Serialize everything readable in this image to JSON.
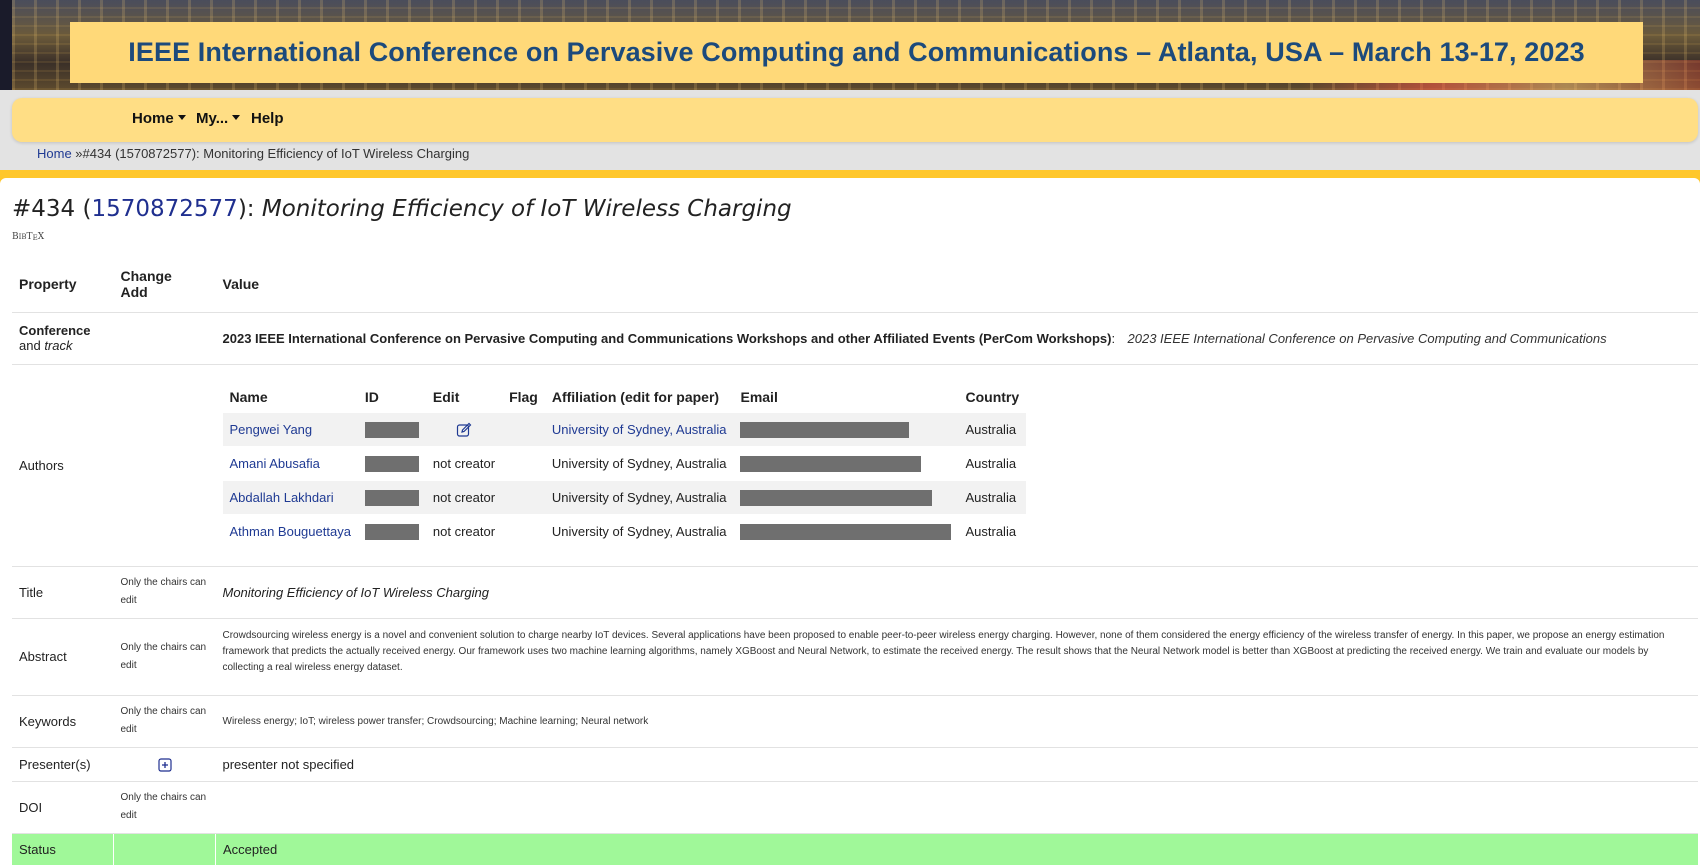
{
  "banner": {
    "title": "IEEE International Conference on Pervasive Computing and Communications – Atlanta, USA – March 13-17, 2023"
  },
  "nav": {
    "home": "Home",
    "my": "My...",
    "help": "Help"
  },
  "breadcrumb": {
    "home": "Home",
    "separator": " »",
    "current": "#434 (1570872577): Monitoring Efficiency of IoT Wireless Charging"
  },
  "paper": {
    "number": "#434",
    "open_paren": " (",
    "id": "1570872577",
    "close_paren": "): ",
    "title": "Monitoring Efficiency of IoT Wireless Charging",
    "bibtex": "BIBTEX"
  },
  "table": {
    "headers": {
      "property": "Property",
      "change": "Change",
      "add": "Add",
      "value": "Value"
    },
    "conference": {
      "label": "Conference",
      "label2_prefix": "and ",
      "label2_em": "track",
      "name": "2023 IEEE International Conference on Pervasive Computing and Communications Workshops and other Affiliated Events (PerCom Workshops)",
      "colon": ":",
      "track": "2023 IEEE International Conference on Pervasive Computing and Communications"
    },
    "authors": {
      "label": "Authors",
      "columns": [
        "Name",
        "ID",
        "Edit",
        "Flag",
        "Affiliation (edit for paper)",
        "Email",
        "Country"
      ],
      "rows": [
        {
          "name": "Pengwei Yang",
          "edit": "",
          "affiliation": "University of Sydney, Australia",
          "affiliation_link": true,
          "country": "Australia",
          "email_redact_frac": 0.8
        },
        {
          "name": "Amani Abusafia",
          "edit": "not creator",
          "affiliation": "University of Sydney, Australia",
          "affiliation_link": false,
          "country": "Australia",
          "email_redact_frac": 0.86
        },
        {
          "name": "Abdallah Lakhdari",
          "edit": "not creator",
          "affiliation": "University of Sydney, Australia",
          "affiliation_link": false,
          "country": "Australia",
          "email_redact_frac": 0.91
        },
        {
          "name": "Athman Bouguettaya",
          "edit": "not creator",
          "affiliation": "University of Sydney, Australia",
          "affiliation_link": false,
          "country": "Australia",
          "email_redact_frac": 1.0
        }
      ]
    },
    "title_row": {
      "label": "Title",
      "note": "Only the chairs can edit",
      "value": "Monitoring Efficiency of IoT Wireless Charging"
    },
    "abstract_row": {
      "label": "Abstract",
      "note": "Only the chairs can edit",
      "value": "Crowdsourcing wireless energy is a novel and convenient solution to charge nearby IoT devices. Several applications have been proposed to enable peer-to-peer wireless energy charging. However, none of them considered the energy efficiency of the wireless transfer of energy. In this paper, we propose an energy estimation framework that predicts the actually received energy. Our framework uses two machine learning algorithms, namely XGBoost and Neural Network, to estimate the received energy. The result shows that the Neural Network model is better than XGBoost at predicting the received energy. We train and evaluate our models by collecting a real wireless energy dataset."
    },
    "keywords_row": {
      "label": "Keywords",
      "note": "Only the chairs can edit",
      "value": "Wireless energy; IoT; wireless power transfer; Crowdsourcing; Machine learning; Neural network"
    },
    "presenters_row": {
      "label": "Presenter(s)",
      "value": "presenter not specified"
    },
    "doi_row": {
      "label": "DOI",
      "note": "Only the chairs can edit",
      "value": ""
    },
    "status_row": {
      "label": "Status",
      "value": "Accepted"
    }
  },
  "colors": {
    "banner_box": "#ffd979",
    "banner_text": "#1c4a7c",
    "navbar": "#ffde85",
    "accent_strip": "#ffc72c",
    "link": "#1f3a93",
    "status_bg": "#a0f899",
    "redaction": "#6f6f6f"
  }
}
